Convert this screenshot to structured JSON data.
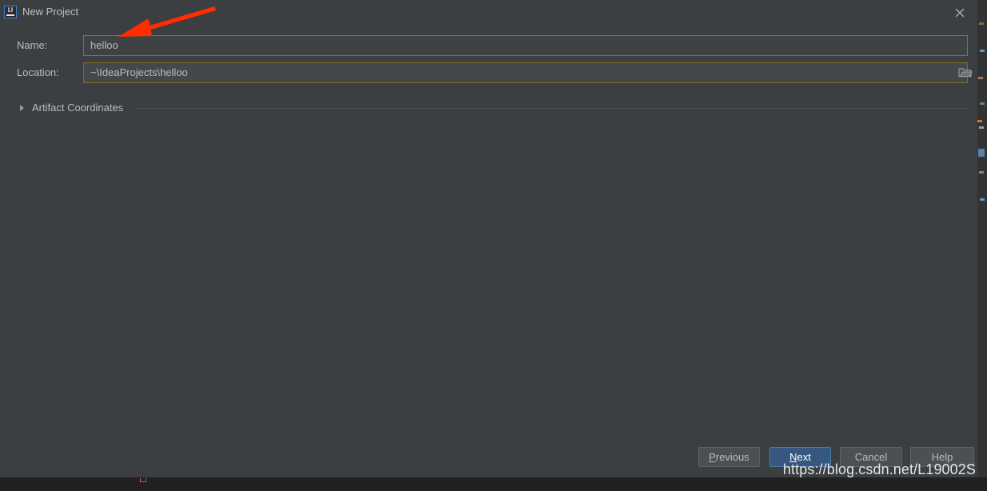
{
  "window": {
    "title": "New Project",
    "app_icon": "intellij-idea-icon",
    "icon_text": "IJ",
    "close_label": "✕"
  },
  "form": {
    "fields": [
      {
        "label": "Name:",
        "value": "helloo",
        "state": "focused",
        "border_color": "#4a7ba8",
        "has_browse": false
      },
      {
        "label": "Location:",
        "value": "~\\IdeaProjects\\helloo",
        "state": "warning",
        "border_color": "#8a6d1f",
        "has_browse": true,
        "browse_icon": "folder-icon"
      }
    ]
  },
  "section": {
    "title": "Artifact Coordinates",
    "expanded": false,
    "arrow_icon": "triangle-right-icon"
  },
  "buttons": [
    {
      "label": "Previous",
      "mnemonic": "P",
      "default": false
    },
    {
      "label": "Next",
      "mnemonic": "N",
      "default": true
    },
    {
      "label": "Cancel",
      "mnemonic": "",
      "default": false
    },
    {
      "label": "Help",
      "mnemonic": "",
      "default": false
    }
  ],
  "annotation": {
    "type": "arrow",
    "color": "#ff2d00",
    "points_to": "name-input"
  },
  "watermark": {
    "text": "https://blog.csdn.net/L19002S"
  },
  "colors": {
    "dialog_bg": "#3c3f41",
    "field_bg": "#45484a",
    "accent_blue": "#365880",
    "text": "#bbbbbb",
    "strip_bg": "#212121"
  }
}
